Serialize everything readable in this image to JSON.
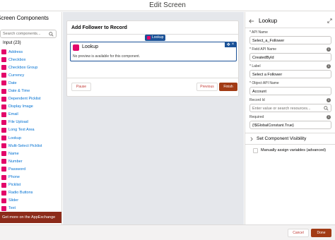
{
  "window": {
    "title": "Edit Screen"
  },
  "palette": {
    "header": "Screen Components",
    "search_placeholder": "Search components...",
    "section_label": "Input (23)",
    "items": [
      {
        "label": "Address",
        "icon": "address-icon",
        "color": "#e3066a"
      },
      {
        "label": "Checkbox",
        "icon": "checkbox-icon",
        "color": "#e3066a"
      },
      {
        "label": "Checkbox Group",
        "icon": "checkbox-group-icon",
        "color": "#e3066a"
      },
      {
        "label": "Currency",
        "icon": "currency-icon",
        "color": "#e3066a"
      },
      {
        "label": "Date",
        "icon": "date-icon",
        "color": "#e3066a"
      },
      {
        "label": "Date & Time",
        "icon": "date-time-icon",
        "color": "#e3066a"
      },
      {
        "label": "Dependent Picklist",
        "icon": "dependent-picklist-icon",
        "color": "#e3066a"
      },
      {
        "label": "Display Image",
        "icon": "display-image-icon",
        "color": "#e3066a"
      },
      {
        "label": "Email",
        "icon": "email-icon",
        "color": "#e3066a"
      },
      {
        "label": "File Upload",
        "icon": "file-upload-icon",
        "color": "#e3066a"
      },
      {
        "label": "Long Text Area",
        "icon": "long-text-area-icon",
        "color": "#e3066a"
      },
      {
        "label": "Lookup",
        "icon": "lookup-icon",
        "color": "#e3066a"
      },
      {
        "label": "Multi-Select Picklist",
        "icon": "multi-select-picklist-icon",
        "color": "#e3066a"
      },
      {
        "label": "Name",
        "icon": "name-icon",
        "color": "#e3066a"
      },
      {
        "label": "Number",
        "icon": "number-icon",
        "color": "#e3066a"
      },
      {
        "label": "Password",
        "icon": "password-icon",
        "color": "#e3066a"
      },
      {
        "label": "Phone",
        "icon": "phone-icon",
        "color": "#e3066a"
      },
      {
        "label": "Picklist",
        "icon": "picklist-icon",
        "color": "#e3066a"
      },
      {
        "label": "Radio Buttons",
        "icon": "radio-buttons-icon",
        "color": "#e3066a"
      },
      {
        "label": "Slider",
        "icon": "slider-icon",
        "color": "#e3066a"
      },
      {
        "label": "Text",
        "icon": "text-icon",
        "color": "#e3066a"
      }
    ],
    "appexchange_label": "Get more on the AppExchange"
  },
  "canvas": {
    "screen_title": "Add Follower to Record",
    "selected_tag": "Lookup",
    "component_title": "Lookup",
    "component_text": "No preview is available for this component.",
    "pause_label": "Pause",
    "previous_label": "Previous",
    "finish_label": "Finish"
  },
  "properties": {
    "title": "Lookup",
    "api_name_label": "* API Name",
    "api_name_value": "Select_a_Follower",
    "field_api_label": "* Field API Name",
    "field_api_value": "CreatedById",
    "label_label": "* Label",
    "label_value": "Select a Follower",
    "object_label": "* Object API Name",
    "object_value": "Account",
    "record_label": "Record Id",
    "record_placeholder": "Enter value or search resources...",
    "required_label": "Required",
    "required_value": "{!$GlobalConstant.True}",
    "visibility_label": "Set Component Visibility",
    "manual_label": "Manually assign variables (advanced)"
  },
  "footer": {
    "cancel_label": "Cancel",
    "done_label": "Done"
  },
  "colors": {
    "accent": "#a23b15",
    "selection": "#1b5297",
    "lookup_icon": "#e3066a",
    "link": "#0070d2"
  }
}
